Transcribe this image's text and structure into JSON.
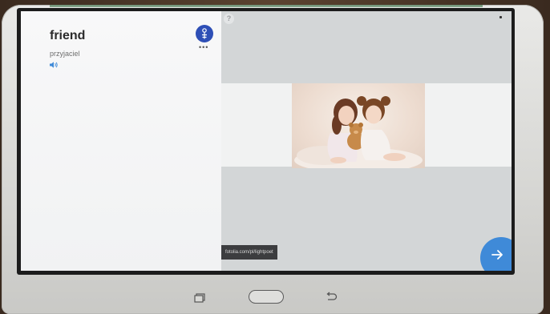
{
  "card": {
    "word": "friend",
    "translation": "przyjaciel",
    "speaker_icon": "speaker-icon",
    "more_label": "•••"
  },
  "help": {
    "label": "?"
  },
  "image": {
    "credit": "fotolia.com/pl/lightpoet"
  },
  "nav": {
    "next_icon": "arrow-right-icon"
  },
  "device": {
    "recent_icon": "recent-apps-icon",
    "home_icon": "home-button",
    "back_icon": "back-icon"
  },
  "colors": {
    "accent": "#3f8ad8",
    "avatar": "#2e4fb6"
  }
}
